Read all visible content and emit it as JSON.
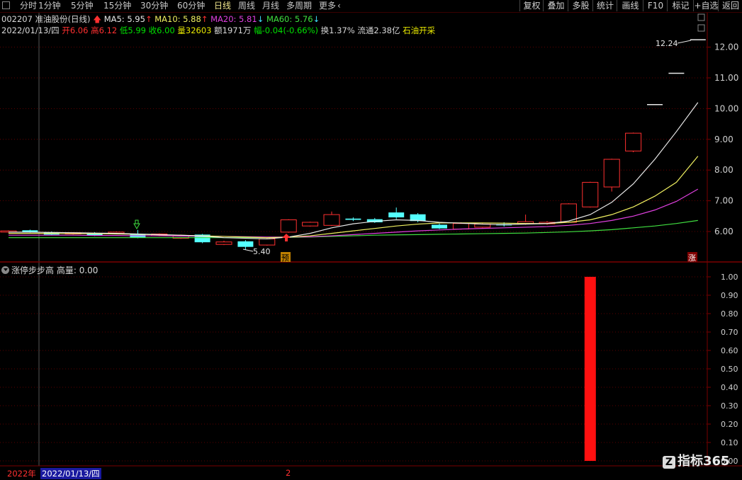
{
  "toolbar": {
    "periods": [
      "分时",
      "1分钟",
      "5分钟",
      "15分钟",
      "30分钟",
      "60分钟",
      "日线",
      "周线",
      "月线",
      "多周期",
      "更多"
    ],
    "active_period": "日线",
    "right_buttons": [
      "复权",
      "叠加",
      "多股",
      "统计",
      "画线",
      "F10",
      "标记",
      "+自选",
      "返回"
    ]
  },
  "stock": {
    "code": "002207",
    "name": "准油股份",
    "period_tag": "(日线)",
    "ma5_label": "MA5: 5.95",
    "ma10_label": "MA10: 5.88",
    "ma20_label": "MA20: 5.81",
    "ma60_label": "MA60: 5.76",
    "date": "2022/01/13/四",
    "open": "开6.06",
    "high": "高6.12",
    "low": "低5.99",
    "close": "收6.00",
    "volume": "量32603",
    "amount": "额1971万",
    "change": "幅-0.04(-0.66%)",
    "turnover": "换1.37%",
    "float": "流通2.38亿",
    "sector": "石油开采"
  },
  "price_axis": [
    "12.00",
    "11.00",
    "10.00",
    "9.00",
    "8.00",
    "7.00",
    "6.00"
  ],
  "indicator_axis": [
    "1.00",
    "0.90",
    "0.80",
    "0.70",
    "0.60",
    "0.50",
    "0.40",
    "0.30",
    "0.20",
    "0.10",
    "0.00"
  ],
  "indicator": {
    "name": "涨停步步高",
    "value_label": "高量: 0.00"
  },
  "annotations": {
    "max_price": "12.24",
    "min_price": "5.40",
    "pre_tag": "预",
    "limit_tag": "涨"
  },
  "axis_bar": {
    "year": "2022年",
    "date": "2022/01/13/四",
    "tick": "2"
  },
  "watermark": {
    "logo": "Z",
    "text": "指标365"
  },
  "colors": {
    "up": "#ff3030",
    "down": "#54ffff",
    "ma5": "#e8e8e8",
    "ma10": "#f0f060",
    "ma20": "#e040e0",
    "ma60": "#40e040",
    "indicator_bar": "#ff1010",
    "grid": "#7a0000"
  },
  "chart_data": {
    "type": "candlestick",
    "ylim": [
      5.2,
      12.5
    ],
    "candles": [
      {
        "o": 5.98,
        "c": 6.02,
        "h": 6.04,
        "l": 5.96
      },
      {
        "o": 6.04,
        "c": 5.98,
        "h": 6.06,
        "l": 5.96
      },
      {
        "o": 5.98,
        "c": 5.9,
        "h": 6.0,
        "l": 5.88
      },
      {
        "o": 5.92,
        "c": 5.96,
        "h": 5.98,
        "l": 5.9
      },
      {
        "o": 5.95,
        "c": 5.87,
        "h": 5.98,
        "l": 5.85
      },
      {
        "o": 5.94,
        "c": 5.98,
        "h": 6.0,
        "l": 5.92
      },
      {
        "o": 5.92,
        "c": 5.8,
        "h": 6.05,
        "l": 5.78
      },
      {
        "o": 5.86,
        "c": 5.92,
        "h": 5.94,
        "l": 5.84
      },
      {
        "o": 5.78,
        "c": 5.86,
        "h": 5.9,
        "l": 5.76
      },
      {
        "o": 5.9,
        "c": 5.65,
        "h": 5.92,
        "l": 5.62
      },
      {
        "o": 5.58,
        "c": 5.66,
        "h": 5.7,
        "l": 5.56
      },
      {
        "o": 5.68,
        "c": 5.5,
        "h": 5.72,
        "l": 5.4
      },
      {
        "o": 5.56,
        "c": 5.76,
        "h": 5.8,
        "l": 5.54
      },
      {
        "o": 5.98,
        "c": 6.38,
        "h": 6.4,
        "l": 5.96
      },
      {
        "o": 6.18,
        "c": 6.3,
        "h": 6.32,
        "l": 6.16
      },
      {
        "o": 6.2,
        "c": 6.55,
        "h": 6.65,
        "l": 6.18
      },
      {
        "o": 6.42,
        "c": 6.38,
        "h": 6.46,
        "l": 6.34
      },
      {
        "o": 6.4,
        "c": 6.3,
        "h": 6.44,
        "l": 6.28
      },
      {
        "o": 6.62,
        "c": 6.46,
        "h": 6.78,
        "l": 6.4
      },
      {
        "o": 6.56,
        "c": 6.34,
        "h": 6.6,
        "l": 6.3
      },
      {
        "o": 6.22,
        "c": 6.1,
        "h": 6.26,
        "l": 6.08
      },
      {
        "o": 6.08,
        "c": 6.26,
        "h": 6.3,
        "l": 6.06
      },
      {
        "o": 6.14,
        "c": 6.24,
        "h": 6.28,
        "l": 6.12
      },
      {
        "o": 6.24,
        "c": 6.2,
        "h": 6.3,
        "l": 6.16
      },
      {
        "o": 6.26,
        "c": 6.32,
        "h": 6.55,
        "l": 6.22
      },
      {
        "o": 6.25,
        "c": 6.3,
        "h": 6.34,
        "l": 6.22
      },
      {
        "o": 6.3,
        "c": 6.9,
        "h": 6.92,
        "l": 6.28
      },
      {
        "o": 6.8,
        "c": 7.6,
        "h": 7.62,
        "l": 6.78
      },
      {
        "o": 7.45,
        "c": 8.35,
        "h": 8.37,
        "l": 7.3
      },
      {
        "o": 8.62,
        "c": 9.2,
        "h": 9.22,
        "l": 8.58
      },
      {
        "o": 10.13,
        "c": 10.13,
        "h": 10.13,
        "l": 10.13
      },
      {
        "o": 11.15,
        "c": 11.15,
        "h": 11.15,
        "l": 11.15
      },
      {
        "o": 12.24,
        "c": 12.24,
        "h": 12.24,
        "l": 12.24
      }
    ],
    "ma5": [
      5.98,
      5.98,
      5.97,
      5.96,
      5.95,
      5.94,
      5.92,
      5.9,
      5.88,
      5.85,
      5.8,
      5.78,
      5.76,
      5.82,
      5.94,
      6.12,
      6.25,
      6.33,
      6.38,
      6.36,
      6.3,
      6.27,
      6.24,
      6.22,
      6.24,
      6.26,
      6.34,
      6.55,
      6.95,
      7.55,
      8.35,
      9.25,
      10.2
    ],
    "ma10": [
      5.94,
      5.94,
      5.94,
      5.93,
      5.93,
      5.92,
      5.91,
      5.89,
      5.88,
      5.86,
      5.84,
      5.82,
      5.8,
      5.82,
      5.86,
      5.94,
      6.02,
      6.1,
      6.18,
      6.24,
      6.28,
      6.28,
      6.28,
      6.27,
      6.26,
      6.26,
      6.3,
      6.38,
      6.55,
      6.8,
      7.15,
      7.6,
      8.45
    ],
    "ma20": [
      5.88,
      5.88,
      5.88,
      5.88,
      5.87,
      5.87,
      5.86,
      5.86,
      5.85,
      5.85,
      5.84,
      5.83,
      5.82,
      5.82,
      5.83,
      5.86,
      5.9,
      5.94,
      5.98,
      6.02,
      6.05,
      6.08,
      6.1,
      6.12,
      6.14,
      6.16,
      6.2,
      6.26,
      6.36,
      6.5,
      6.7,
      6.98,
      7.38
    ],
    "ma60": [
      5.8,
      5.8,
      5.8,
      5.8,
      5.8,
      5.8,
      5.8,
      5.8,
      5.8,
      5.8,
      5.8,
      5.8,
      5.8,
      5.81,
      5.82,
      5.84,
      5.86,
      5.88,
      5.89,
      5.9,
      5.91,
      5.92,
      5.93,
      5.94,
      5.95,
      5.97,
      5.99,
      6.02,
      6.06,
      6.12,
      6.18,
      6.26,
      6.36
    ],
    "indicator": {
      "ylim": [
        0,
        1.05
      ],
      "values": [
        0,
        0,
        0,
        0,
        0,
        0,
        0,
        0,
        0,
        0,
        0,
        0,
        0,
        0,
        0,
        0,
        0,
        0,
        0,
        0,
        0,
        0,
        0,
        0,
        0,
        0,
        0,
        1.0,
        0,
        0,
        0,
        0,
        0
      ]
    }
  }
}
